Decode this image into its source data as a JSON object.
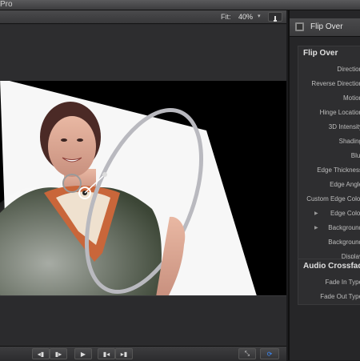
{
  "window": {
    "title": "Pro"
  },
  "viewer": {
    "fit_label": "Fit:",
    "zoom_value": "40%",
    "zoom_chevron": "▾",
    "tool_icon": "brush-icon"
  },
  "transport": {
    "buttons": [
      "◂▮",
      "▮▸",
      "▶",
      "▮◂",
      "▸▮",
      "⤡",
      "⟳"
    ]
  },
  "inspector": {
    "title": "Flip Over",
    "section_title": "Flip Over",
    "params": [
      "Direction",
      "Reverse Direction",
      "Motion",
      "Hinge Location",
      "3D Intensity",
      "Shading",
      "Blur",
      "Edge Thickness",
      "Edge Angle",
      "Custom Edge Color",
      "Edge Color",
      "Background",
      "Background",
      "Display"
    ],
    "audio_section_title": "Audio Crossfade",
    "audio_params": [
      "Fade In Type",
      "Fade Out Type"
    ]
  },
  "colors": {
    "accent": "#3b8cff",
    "panel": "#262628",
    "canvas": "#000000"
  }
}
